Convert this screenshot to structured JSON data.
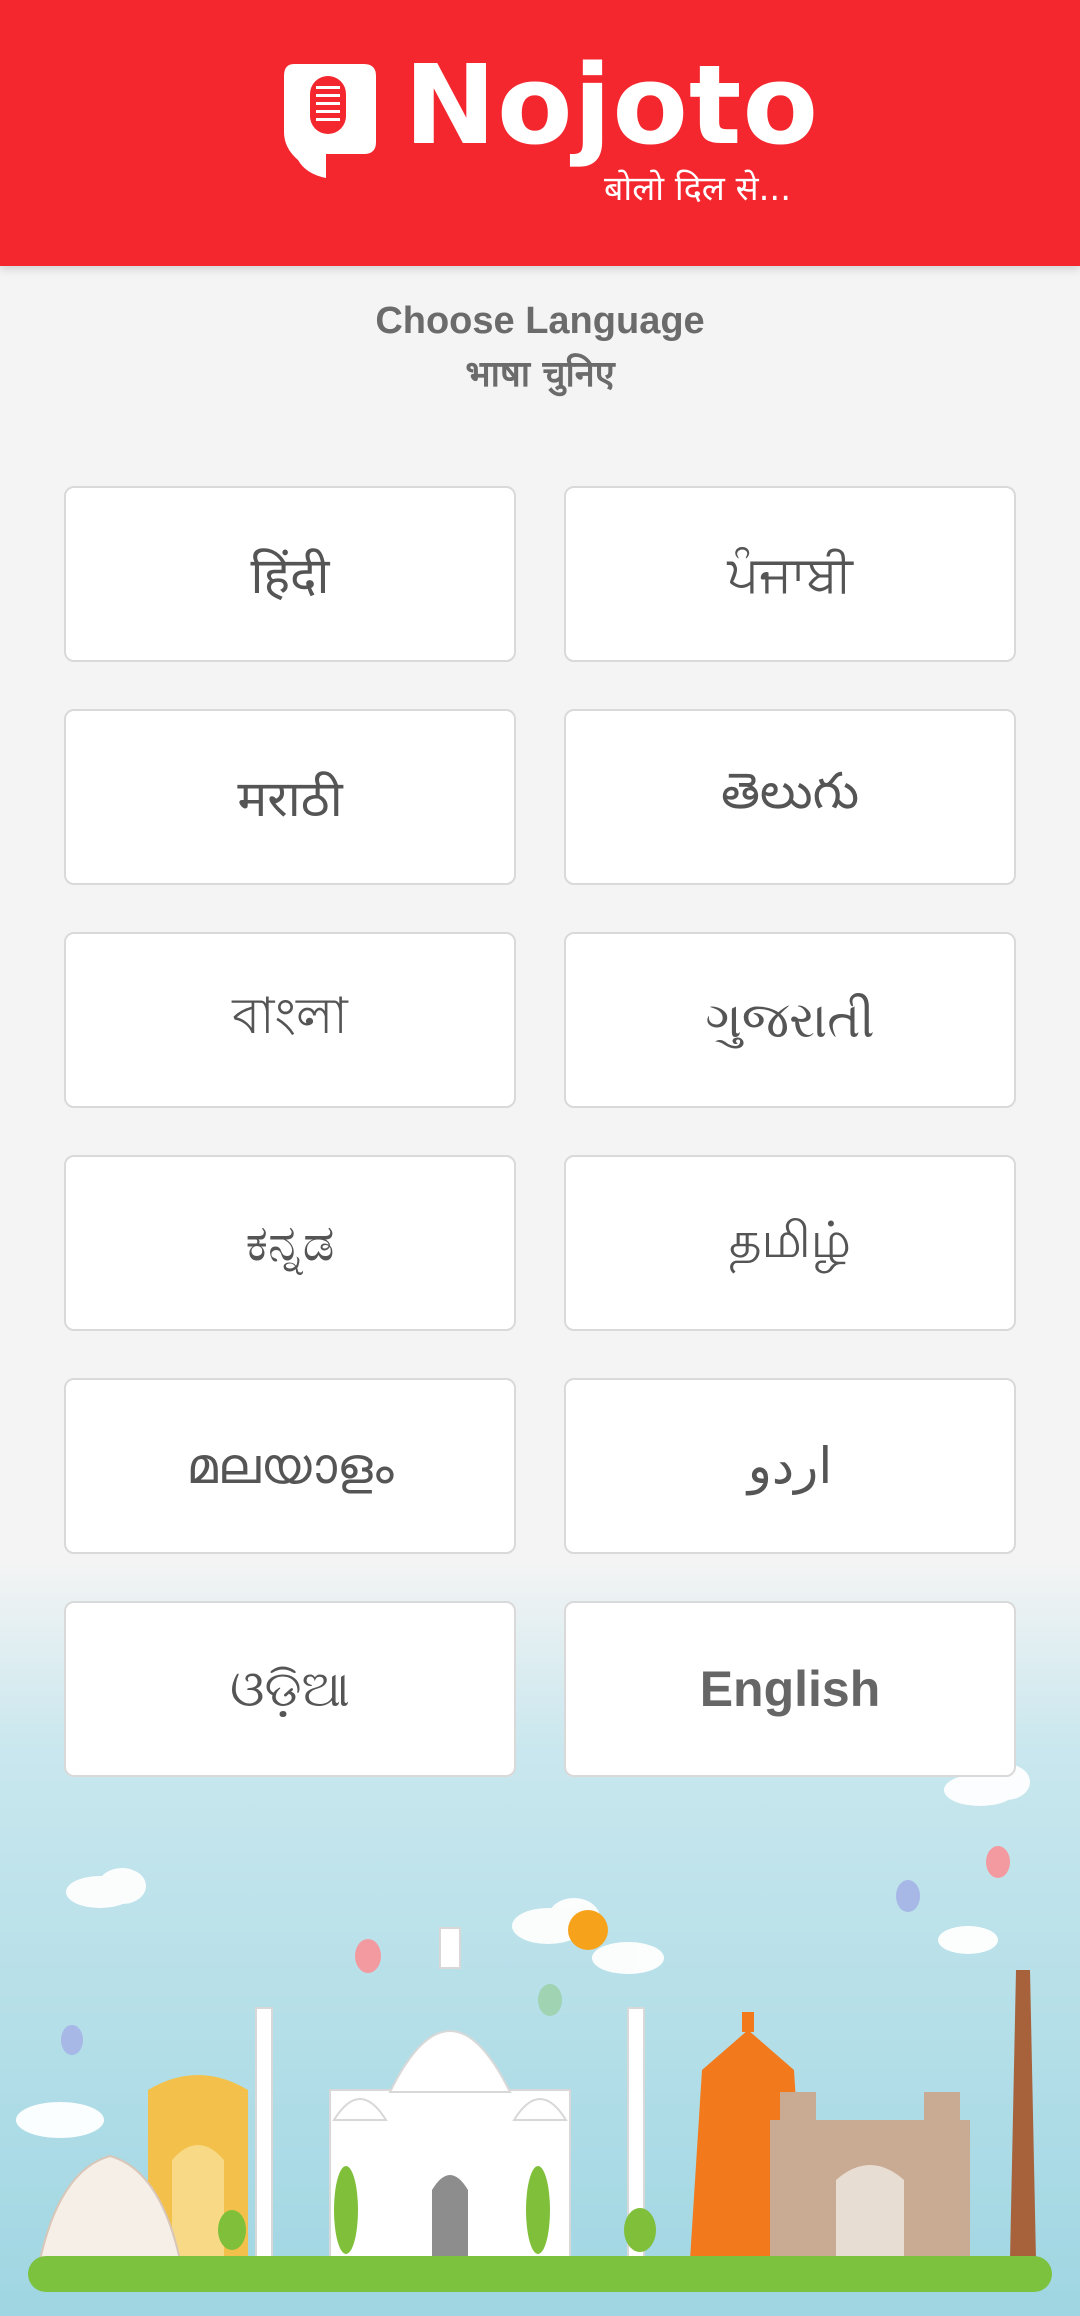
{
  "header": {
    "brand": "Nojoto",
    "tagline": "बोलो दिल से...",
    "background_color": "#f4262e"
  },
  "prompt": {
    "title_en": "Choose Language",
    "title_hi": "भाषा चुनिए"
  },
  "languages": [
    {
      "label": "हिंदी"
    },
    {
      "label": "ਪੰਜਾਬੀ"
    },
    {
      "label": "मराठी"
    },
    {
      "label": "తెలుగు"
    },
    {
      "label": "বাংলা"
    },
    {
      "label": "ગુજરાતી"
    },
    {
      "label": "ಕನ್ನಡ"
    },
    {
      "label": "தமிழ்"
    },
    {
      "label": "മലയാളം"
    },
    {
      "label": "اردو"
    },
    {
      "label": "ଓଡ଼ିଆ"
    },
    {
      "label": "English"
    }
  ]
}
